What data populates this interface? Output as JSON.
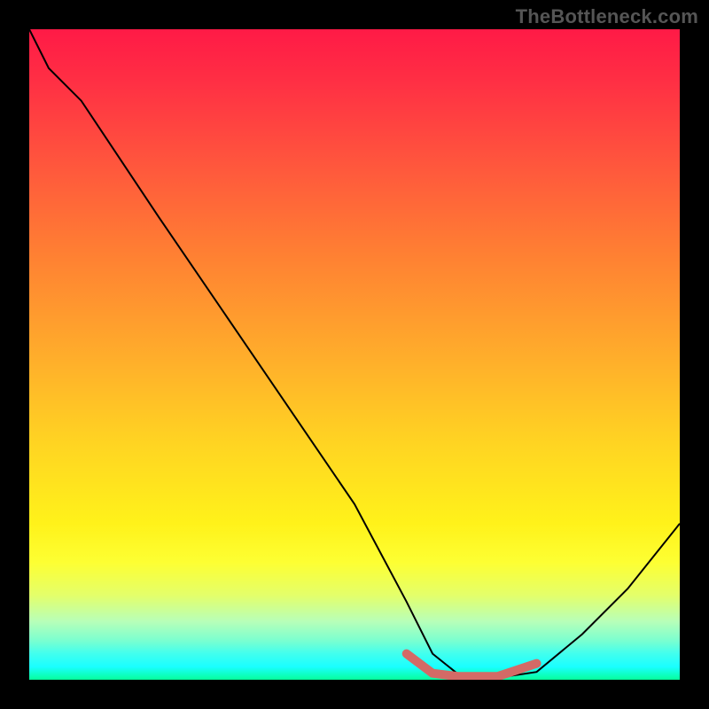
{
  "watermark": "TheBottleneck.com",
  "chart_data": {
    "type": "line",
    "title": "",
    "xlabel": "",
    "ylabel": "",
    "xlim": [
      0,
      100
    ],
    "ylim": [
      0,
      100
    ],
    "grid": false,
    "series": [
      {
        "name": "curve",
        "x": [
          0,
          3,
          8,
          20,
          35,
          50,
          58,
          62,
          66,
          72,
          78,
          85,
          92,
          100
        ],
        "y": [
          100,
          94,
          89,
          71,
          49,
          27,
          12,
          4,
          0.8,
          0.3,
          1.2,
          7,
          14,
          24
        ]
      }
    ],
    "highlight": {
      "name": "optimal-region",
      "color": "#d36a66",
      "x": [
        58,
        62,
        66,
        72,
        78
      ],
      "y": [
        4,
        1.0,
        0.5,
        0.5,
        2.5
      ]
    },
    "legend": false
  }
}
